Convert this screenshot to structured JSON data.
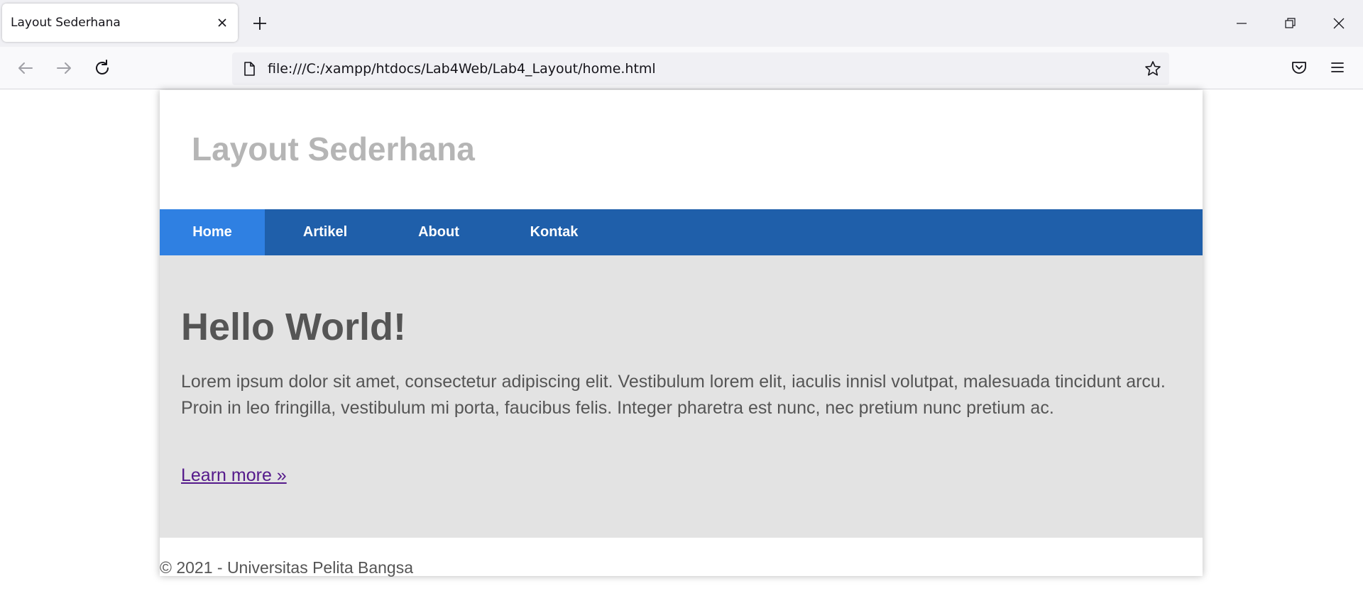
{
  "browser": {
    "tab": {
      "title": "Layout Sederhana"
    },
    "url": "file:///C:/xampp/htdocs/Lab4Web/Lab4_Layout/home.html",
    "icons": {
      "tab_close": "close-icon",
      "new_tab": "plus-icon",
      "minimize": "minimize-icon",
      "restore": "restore-icon",
      "window_close": "close-icon",
      "back": "back-arrow-icon",
      "forward": "forward-arrow-icon",
      "reload": "reload-icon",
      "page": "page-icon",
      "bookmark": "star-icon",
      "pocket": "pocket-icon",
      "menu": "hamburger-menu-icon"
    }
  },
  "page": {
    "header": {
      "title": "Layout Sederhana"
    },
    "nav": {
      "items": [
        {
          "label": "Home",
          "active": true
        },
        {
          "label": "Artikel",
          "active": false
        },
        {
          "label": "About",
          "active": false
        },
        {
          "label": "Kontak",
          "active": false
        }
      ]
    },
    "hero": {
      "heading": "Hello World!",
      "text": "Lorem ipsum dolor sit amet, consectetur adipiscing elit. Vestibulum lorem elit, iaculis innisl volutpat, malesuada tincidunt arcu. Proin in leo fringilla, vestibulum mi porta, faucibus felis. Integer pharetra est nunc, nec pretium nunc pretium ac.",
      "link": "Learn more »"
    },
    "footer": {
      "text": "© 2021 - Universitas Pelita Bangsa"
    }
  },
  "colors": {
    "nav_bg": "#1f5faa",
    "nav_active": "#2f80e2",
    "hero_bg": "#e3e3e3",
    "title_gray": "#b5b5b5",
    "text_gray": "#555555",
    "link_visited": "#551a8b"
  }
}
